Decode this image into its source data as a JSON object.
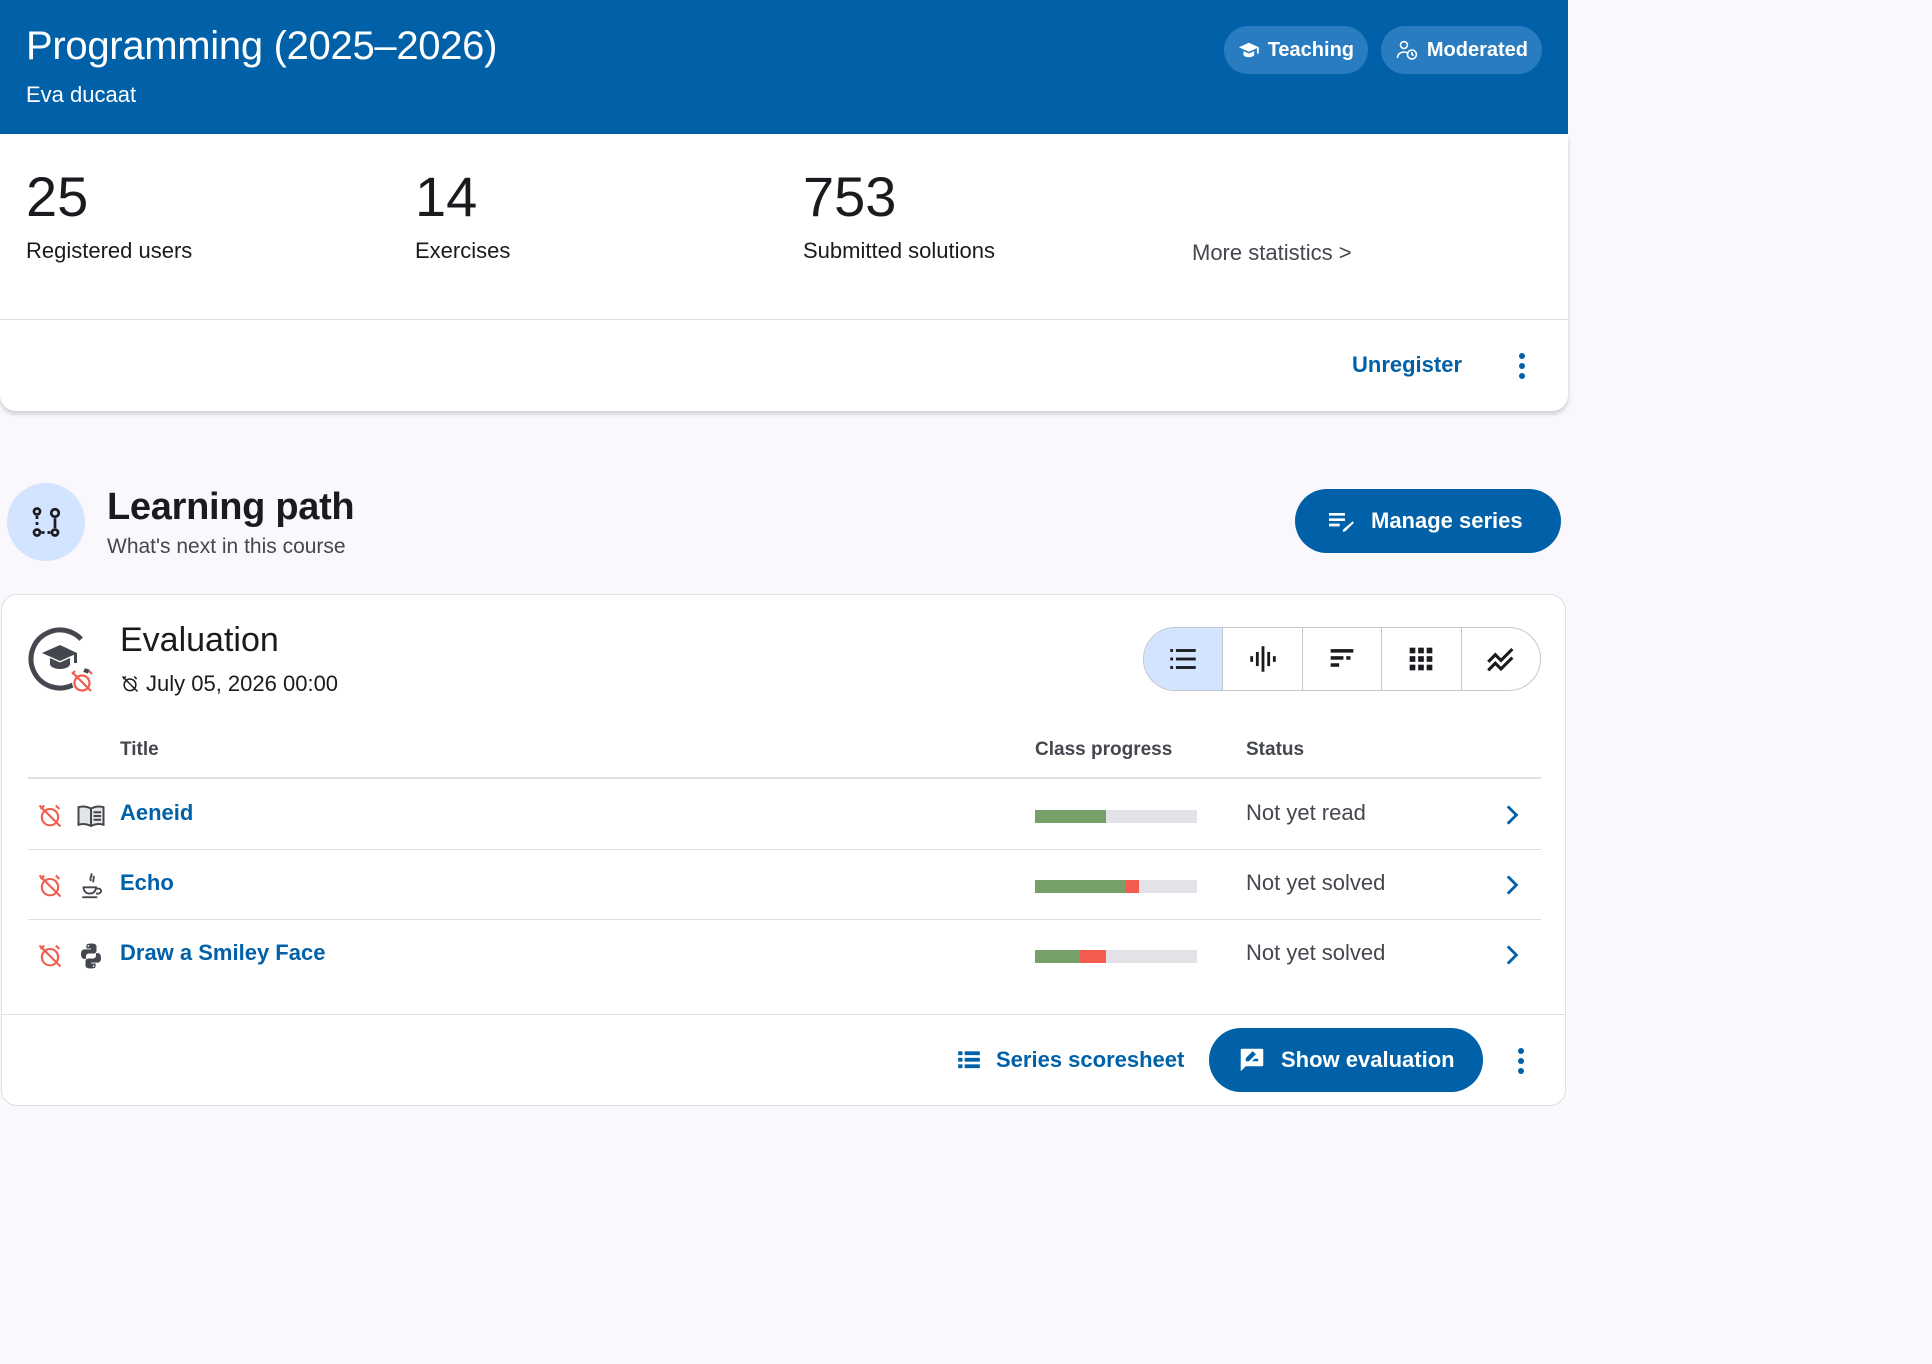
{
  "header": {
    "title": "Programming (2025–2026)",
    "subtitle": "Eva ducaat",
    "chips": [
      {
        "label": "Teaching",
        "icon": "graduation-cap-icon"
      },
      {
        "label": "Moderated",
        "icon": "user-clock-icon"
      }
    ]
  },
  "stats": [
    {
      "value": "25",
      "label": "Registered users"
    },
    {
      "value": "14",
      "label": "Exercises"
    },
    {
      "value": "753",
      "label": "Submitted solutions"
    }
  ],
  "more_statistics": "More statistics >",
  "actions": {
    "unregister": "Unregister"
  },
  "learning_path": {
    "title": "Learning path",
    "subtitle": "What's next in this course",
    "manage_label": "Manage series"
  },
  "series": {
    "title": "Evaluation",
    "deadline": "July 05, 2026 00:00",
    "view_icons": [
      "list-icon",
      "waveform-icon",
      "sorted-bars-icon",
      "grid-icon",
      "trend-lines-icon"
    ],
    "columns": {
      "title": "Title",
      "progress": "Class progress",
      "status": "Status"
    },
    "rows": [
      {
        "name": "Aeneid",
        "type_icon": "book-icon",
        "status": "Not yet read",
        "correct": 0.44,
        "wrong": 0.0
      },
      {
        "name": "Echo",
        "type_icon": "java-icon",
        "status": "Not yet solved",
        "correct": 0.56,
        "wrong": 0.08
      },
      {
        "name": "Draw a Smiley Face",
        "type_icon": "python-icon",
        "status": "Not yet solved",
        "correct": 0.28,
        "wrong": 0.16
      }
    ],
    "scoresheet_label": "Series scoresheet",
    "show_evaluation_label": "Show evaluation"
  },
  "colors": {
    "primary": "#0061a8",
    "correct": "#77a069",
    "wrong": "#f25b4e",
    "alarm": "#f25b4e"
  }
}
